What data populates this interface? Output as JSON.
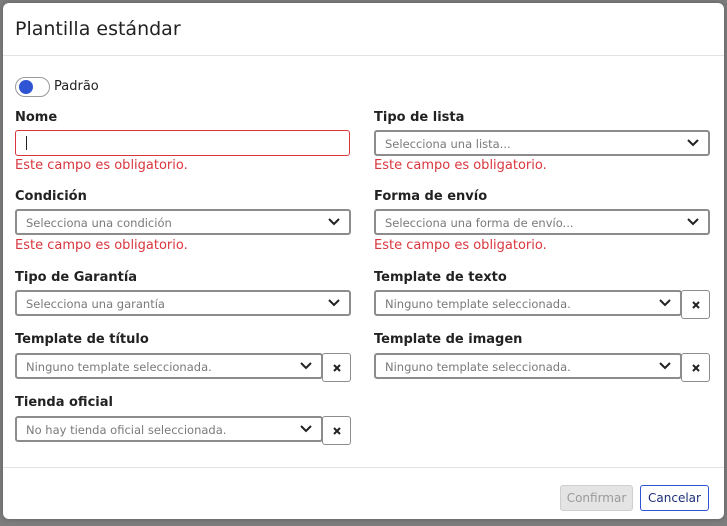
{
  "modal": {
    "title": "Plantilla estándar"
  },
  "toggle": {
    "label": "Padrão",
    "state": "on",
    "color": "#2f55d4"
  },
  "fields": {
    "nombre": {
      "label": "Nome",
      "value": "",
      "error": "Este campo es obligatorio."
    },
    "tipo_lista": {
      "label": "Tipo de lista",
      "placeholder": "Selecciona una lista...",
      "error": "Este campo es obligatorio."
    },
    "condicion": {
      "label": "Condición",
      "placeholder": "Selecciona una condición",
      "error": "Este campo es obligatorio."
    },
    "forma_envio": {
      "label": "Forma de envío",
      "placeholder": "Selecciona una forma de envío...",
      "error": "Este campo es obligatorio."
    },
    "tipo_garantia": {
      "label": "Tipo de Garantía",
      "placeholder": "Selecciona una garantía"
    },
    "template_texto": {
      "label": "Template de texto",
      "placeholder": "Ninguno template seleccionada."
    },
    "template_titulo": {
      "label": "Template de título",
      "placeholder": "Ninguno template seleccionada."
    },
    "template_imagen": {
      "label": "Template de imagen",
      "placeholder": "Ninguno template seleccionada."
    },
    "tienda_oficial": {
      "label": "Tienda oficial",
      "placeholder": "No hay tienda oficial seleccionada."
    }
  },
  "footer": {
    "confirm_label": "Confirmar",
    "cancel_label": "Cancelar"
  },
  "colors": {
    "error": "#d9363e",
    "accent": "#2f55d4"
  }
}
